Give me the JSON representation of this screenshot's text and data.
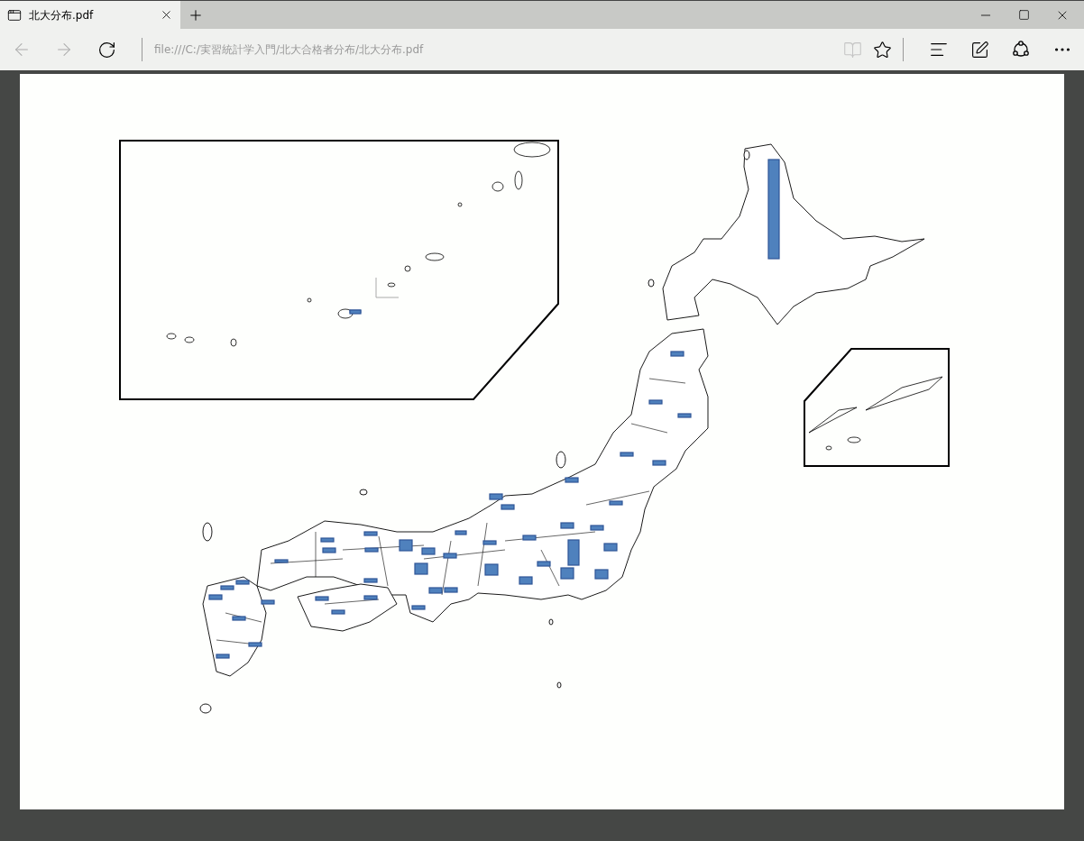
{
  "tabs": [
    {
      "title": "北大分布.pdf",
      "selected": true
    }
  ],
  "nav": {
    "back_disabled": true,
    "forward_disabled": true,
    "reading_view_disabled": true
  },
  "address": {
    "value": "file:///C:/実習統計学入門/北大合格者分布/北大分布.pdf"
  }
}
